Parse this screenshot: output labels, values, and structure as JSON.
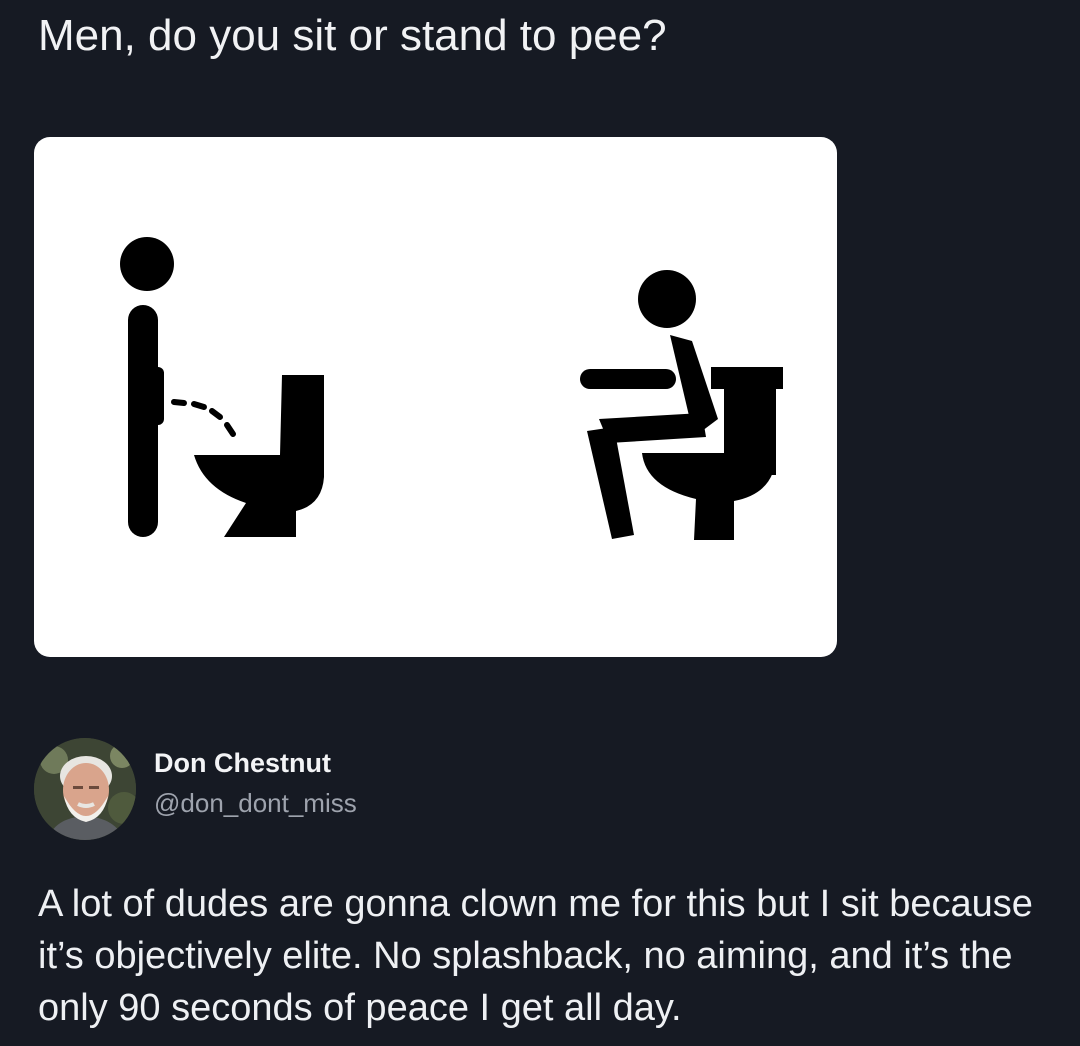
{
  "post": {
    "question": "Men, do you sit or stand to pee?",
    "image": {
      "icons": [
        "standing-urinating-figure-icon",
        "sitting-on-toilet-figure-icon"
      ],
      "background_color": "#ffffff",
      "icon_color": "#000000"
    },
    "author": {
      "display_name": "Don Chestnut",
      "handle": "@don_dont_miss",
      "avatar": "bearded-man-avatar"
    },
    "text": "A lot of dudes are gonna clown me for this but I sit because it’s objectively elite. No splashback, no aiming, and it’s the only 90 seconds of peace I get all day."
  },
  "theme": {
    "background": "#161a23",
    "text_color": "#eef0f3",
    "muted_color": "#9ea3ad"
  }
}
